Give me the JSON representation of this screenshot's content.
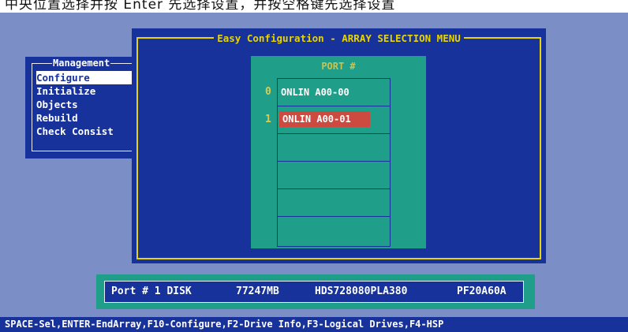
{
  "caption": "中央位置选择并按 Enter 先选择设置，并按空格键先选择设置",
  "management": {
    "title": "Management",
    "items": [
      {
        "label": "Configure",
        "selected": true
      },
      {
        "label": "Initialize",
        "selected": false
      },
      {
        "label": "Objects",
        "selected": false
      },
      {
        "label": "Rebuild",
        "selected": false
      },
      {
        "label": "Check Consist",
        "selected": false
      }
    ]
  },
  "panel": {
    "title": "Easy Configuration - ARRAY SELECTION MENU",
    "port_header": "PORT #",
    "slots": [
      {
        "num": "0",
        "label": "ONLIN A00-00",
        "highlighted": false
      },
      {
        "num": "1",
        "label": "ONLIN A00-01",
        "highlighted": true
      },
      {
        "num": "",
        "label": "",
        "highlighted": false
      },
      {
        "num": "",
        "label": "",
        "highlighted": false
      },
      {
        "num": "",
        "label": "",
        "highlighted": false
      },
      {
        "num": "",
        "label": "",
        "highlighted": false
      }
    ]
  },
  "info": {
    "port": "Port # 1 DISK",
    "size": "77247MB",
    "model": "HDS728080PLA380",
    "firmware": "PF20A60A"
  },
  "keyhelp": "SPACE-Sel,ENTER-EndArray,F10-Configure,F2-Drive Info,F3-Logical Drives,F4-HSP",
  "colors": {
    "screen_bg": "#7b8fc6",
    "panel_bg": "#17329a",
    "teal": "#1f9e8a",
    "yellow": "#e8d400",
    "highlight": "#cc4a40"
  }
}
